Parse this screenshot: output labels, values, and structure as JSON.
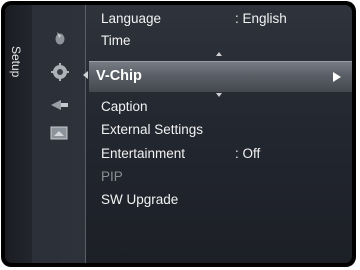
{
  "sidebar": {
    "title": "Setup"
  },
  "icons": [
    "picture-icon",
    "setup-icon",
    "input-icon",
    "application-icon"
  ],
  "menu": {
    "items": [
      {
        "label": "Language",
        "value": ": English"
      },
      {
        "label": "Time",
        "value": ""
      },
      {
        "label": "V-Chip",
        "value": "",
        "selected": true,
        "has_submenu": true
      },
      {
        "label": "Caption",
        "value": ""
      },
      {
        "label": "External Settings",
        "value": ""
      },
      {
        "label": "Entertainment",
        "value": ": Off"
      },
      {
        "label": "PIP",
        "value": "",
        "disabled": true
      },
      {
        "label": "SW Upgrade",
        "value": ""
      }
    ]
  },
  "colors": {
    "background": "#23262d",
    "highlight": "#5a5e66",
    "text": "#f2f2f2",
    "disabled_text": "#8a8d92"
  }
}
